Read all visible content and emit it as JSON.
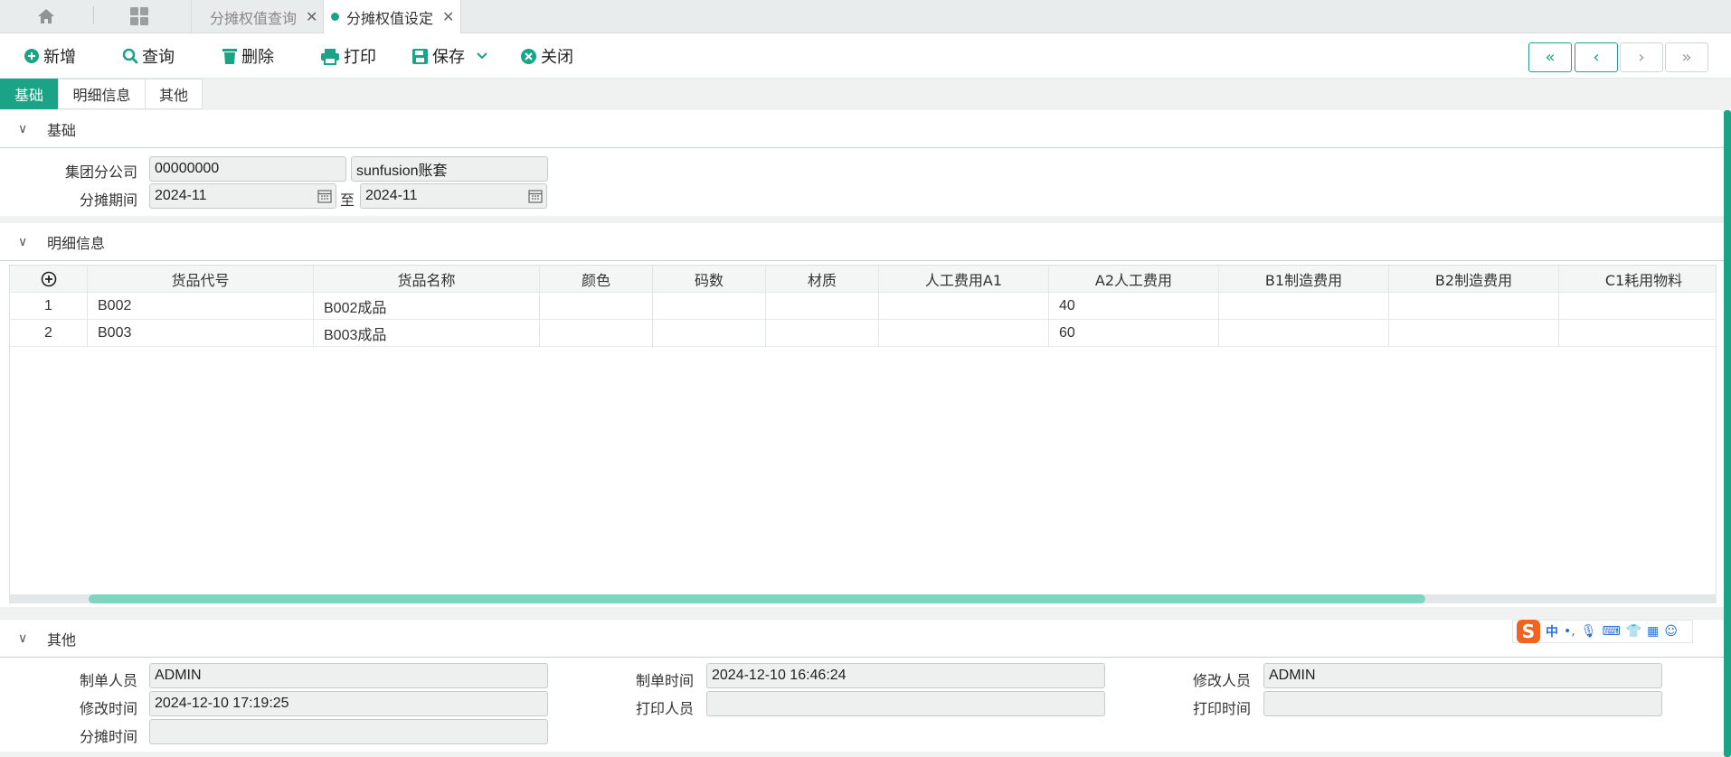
{
  "top_tabs": [
    {
      "label": "分摊权值查询",
      "active": false
    },
    {
      "label": "分摊权值设定",
      "active": true
    }
  ],
  "toolbar": {
    "add": "新增",
    "query": "查询",
    "delete": "删除",
    "print": "打印",
    "save": "保存",
    "close": "关闭"
  },
  "sub_tabs": [
    "基础",
    "明细信息",
    "其他"
  ],
  "basic": {
    "title": "基础",
    "company_label": "集团分公司",
    "company_code": "00000000",
    "company_name": "sunfusion账套",
    "period_label": "分摊期间",
    "period_from": "2024-11",
    "period_to_label": "至",
    "period_to": "2024-11"
  },
  "detail": {
    "title": "明细信息",
    "columns": [
      "货品代号",
      "货品名称",
      "颜色",
      "码数",
      "材质",
      "人工费用A1",
      "A2人工费用",
      "B1制造费用",
      "B2制造费用",
      "C1耗用物料"
    ],
    "rows": [
      {
        "no": "1",
        "cells": [
          "B002",
          "B002成品",
          "",
          "",
          "",
          "",
          "40",
          "",
          "",
          ""
        ]
      },
      {
        "no": "2",
        "cells": [
          "B003",
          "B003成品",
          "",
          "",
          "",
          "",
          "60",
          "",
          "",
          ""
        ]
      }
    ]
  },
  "other": {
    "title": "其他",
    "creator_label": "制单人员",
    "creator": "ADMIN",
    "create_time_label": "制单时间",
    "create_time": "2024-12-10 16:46:24",
    "modifier_label": "修改人员",
    "modifier": "ADMIN",
    "modify_time_label": "修改时间",
    "modify_time": "2024-12-10 17:19:25",
    "printer_label": "打印人员",
    "printer": "",
    "print_time_label": "打印时间",
    "print_time": "",
    "alloc_time_label": "分摊时间",
    "alloc_time": ""
  },
  "ime": {
    "lang": "中"
  },
  "colors": {
    "accent": "#1aa387",
    "scroll_thumb": "#7ed6bf",
    "ime": "#f26322"
  }
}
